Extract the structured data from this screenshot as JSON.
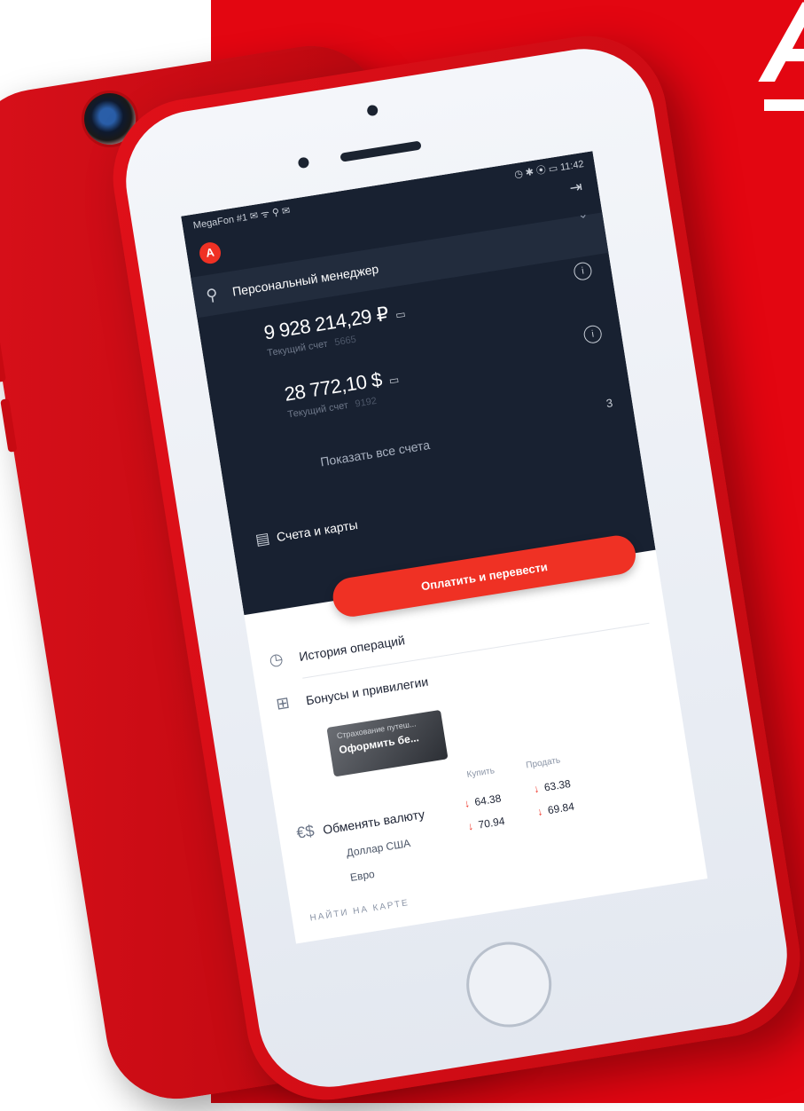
{
  "brand": {
    "letter": "А",
    "colors": {
      "red": "#e30611",
      "accent": "#ef3124",
      "dark": "#182131"
    }
  },
  "status_bar": {
    "left": "MegaFon #1 ✉ ᯤ ⚲ ✉",
    "right": "◷ ✱ ⦿ ▭ 11:42"
  },
  "app": {
    "logo": "A",
    "logout_icon": "logout-icon",
    "manager_label": "Персональный менеджер",
    "accounts": [
      {
        "amount": "9 928 214,29 ₽",
        "label": "Текущий счет",
        "number": "5665"
      },
      {
        "amount": "28 772,10 $",
        "label": "Текущий счет",
        "number": "9192"
      }
    ],
    "hidden_accounts_count": "3",
    "show_all_label": "Показать все счета",
    "accounts_cards_label": "Счета и карты",
    "pay_button_label": "Оплатить и перевести",
    "history_label": "История операций",
    "bonuses_label": "Бонусы и привилегии",
    "promo": {
      "subtitle": "Страхование путеш...",
      "title": "Оформить бе..."
    },
    "fx": {
      "title": "Обменять валюту",
      "buy_label": "Купить",
      "sell_label": "Продать",
      "rows": [
        {
          "name": "Доллар США",
          "buy": "64.38",
          "sell": "63.38"
        },
        {
          "name": "Евро",
          "buy": "70.94",
          "sell": "69.84"
        }
      ]
    },
    "map_link_label": "НАЙТИ НА КАРТЕ"
  }
}
